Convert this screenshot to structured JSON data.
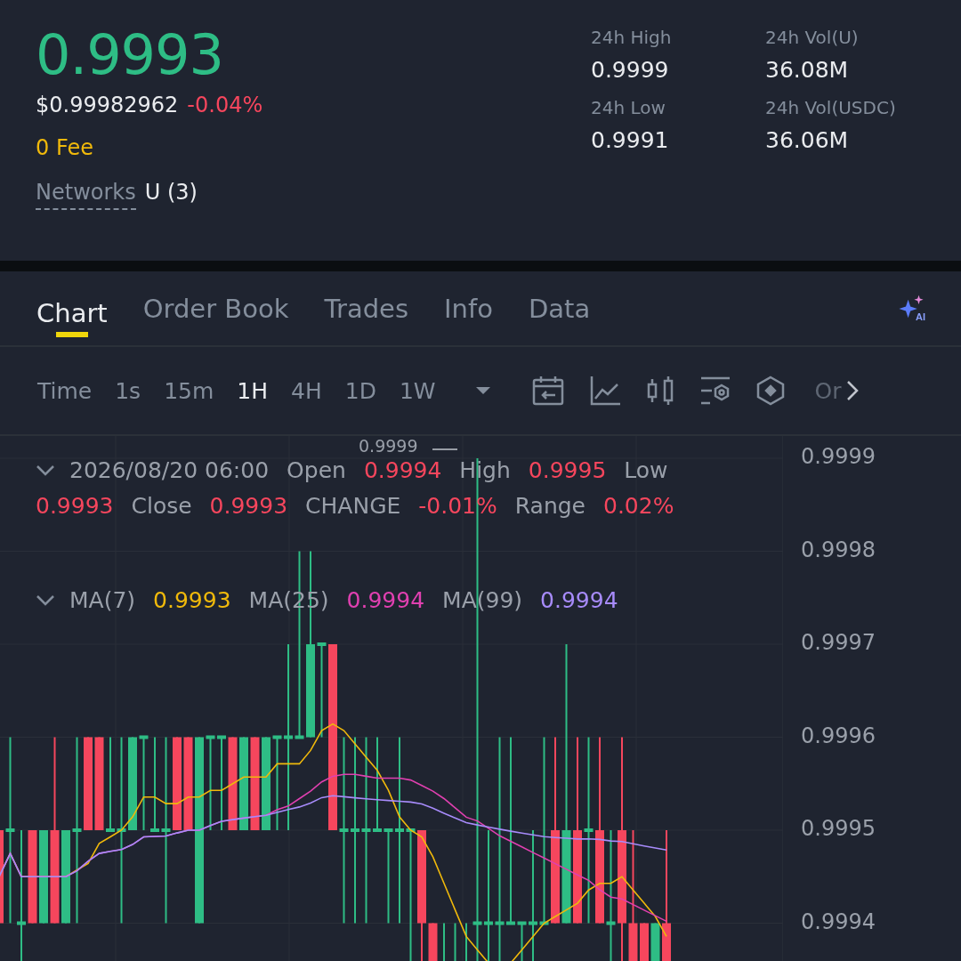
{
  "price": {
    "last": "0.9993",
    "usd": "$0.99982962",
    "change": "-0.04%",
    "fee": "0 Fee",
    "networks_label": "Networks",
    "networks_value": "U (3)"
  },
  "stats": [
    {
      "label": "24h High",
      "value": "0.9999"
    },
    {
      "label": "24h Vol(U)",
      "value": "36.08M"
    },
    {
      "label": "24h Low",
      "value": "0.9991"
    },
    {
      "label": "24h Vol(USDC)",
      "value": "36.06M"
    }
  ],
  "tabs": [
    {
      "label": "Chart",
      "selected": true
    },
    {
      "label": "Order Book",
      "selected": false
    },
    {
      "label": "Trades",
      "selected": false
    },
    {
      "label": "Info",
      "selected": false
    },
    {
      "label": "Data",
      "selected": false
    }
  ],
  "ai_button": "AI",
  "intervals": [
    {
      "label": "Time",
      "selected": false
    },
    {
      "label": "1s",
      "selected": false
    },
    {
      "label": "15m",
      "selected": false
    },
    {
      "label": "1H",
      "selected": true
    },
    {
      "label": "4H",
      "selected": false
    },
    {
      "label": "1D",
      "selected": false
    },
    {
      "label": "1W",
      "selected": false
    }
  ],
  "toolbar_more": "Or",
  "chart": {
    "candle_info": [
      {
        "text": "2026/08/20 06:00",
        "kind": "label"
      },
      {
        "text": "Open",
        "kind": "label"
      },
      {
        "text": "0.9994",
        "kind": "down"
      },
      {
        "text": "High",
        "kind": "label"
      },
      {
        "text": "0.9995",
        "kind": "down"
      },
      {
        "text": "Low",
        "kind": "label"
      },
      {
        "text": "0.9993",
        "kind": "down"
      },
      {
        "text": "Close",
        "kind": "label"
      },
      {
        "text": "0.9993",
        "kind": "down"
      },
      {
        "text": "CHANGE",
        "kind": "label"
      },
      {
        "text": "-0.01%",
        "kind": "down"
      },
      {
        "text": "Range",
        "kind": "label"
      },
      {
        "text": "0.02%",
        "kind": "down"
      }
    ],
    "moving_averages": [
      {
        "label": "MA(7)",
        "value": "0.9993",
        "color": "#f0b90b"
      },
      {
        "label": "MA(25)",
        "value": "0.9994",
        "color": "#e040b0"
      },
      {
        "label": "MA(99)",
        "value": "0.9994",
        "color": "#a78bfa"
      }
    ],
    "high_marker": "0.9999",
    "price_axis": [
      "0.9999",
      "0.9998",
      "0.9997",
      "0.9996",
      "0.9995",
      "0.9994"
    ]
  }
}
